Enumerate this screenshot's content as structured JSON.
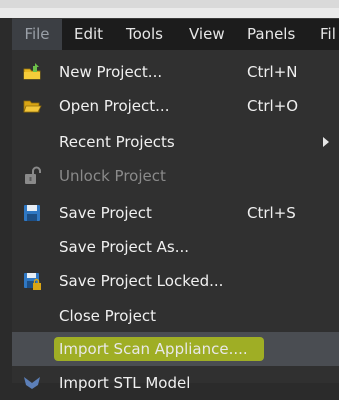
{
  "menubar": {
    "items": [
      "File",
      "Edit",
      "Tools",
      "View",
      "Panels",
      "Fil"
    ]
  },
  "menu": {
    "items": [
      {
        "label": "New Project...",
        "shortcut": "Ctrl+N",
        "icon": "new-project-icon"
      },
      {
        "label": "Open Project...",
        "shortcut": "Ctrl+O",
        "icon": "folder-open-icon"
      },
      {
        "label": "Recent Projects",
        "shortcut": "",
        "icon": "",
        "submenu": true
      },
      {
        "label": "Unlock Project",
        "shortcut": "",
        "icon": "unlock-icon",
        "disabled": true
      },
      {
        "label": "Save Project",
        "shortcut": "Ctrl+S",
        "icon": "floppy-disk-icon"
      },
      {
        "label": "Save Project As...",
        "shortcut": "",
        "icon": ""
      },
      {
        "label": "Save Project Locked...",
        "shortcut": "",
        "icon": "floppy-lock-icon"
      },
      {
        "label": "Close Project",
        "shortcut": "",
        "icon": ""
      },
      {
        "label": "Import Scan Appliance....",
        "shortcut": "",
        "icon": "",
        "highlighted": true
      },
      {
        "label": "Import STL Model",
        "shortcut": "",
        "icon": "stl-model-icon"
      }
    ]
  },
  "colors": {
    "menu_bg": "#303030",
    "highlight_marker": "#e6ff00"
  }
}
